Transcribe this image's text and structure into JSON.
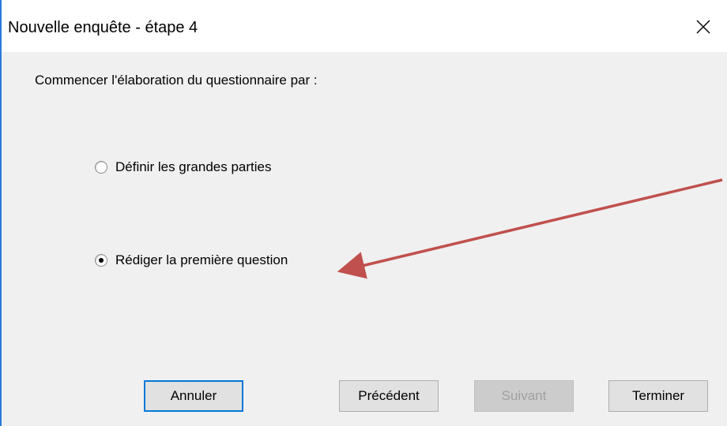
{
  "window": {
    "title": "Nouvelle enquête - étape 4",
    "close_icon": "close-icon",
    "border_color": "#2b79d8"
  },
  "content": {
    "prompt": "Commencer l'élaboration du questionnaire par :",
    "options": [
      {
        "label": "Définir les grandes parties",
        "selected": false
      },
      {
        "label": "Rédiger la première question",
        "selected": true
      }
    ]
  },
  "buttons": {
    "cancel": "Annuler",
    "previous": "Précédent",
    "next": "Suivant",
    "next_disabled": true,
    "finish": "Terminer"
  },
  "annotation": {
    "arrow_color": "#c0504d",
    "points_to": "Rédiger la première question"
  }
}
